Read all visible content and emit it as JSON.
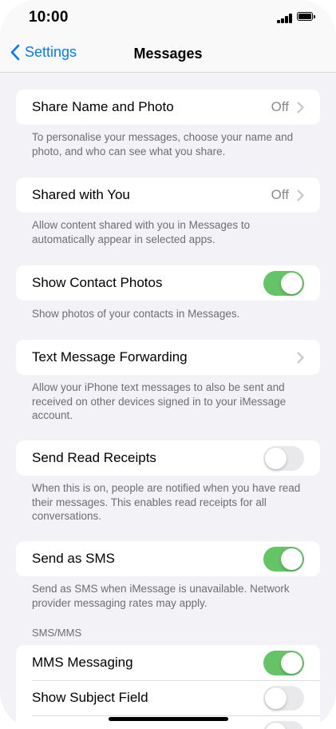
{
  "status_bar": {
    "time": "10:00"
  },
  "nav": {
    "back_label": "Settings",
    "title": "Messages"
  },
  "rows": {
    "share_name_photo": {
      "label": "Share Name and Photo",
      "value": "Off"
    },
    "shared_with_you": {
      "label": "Shared with You",
      "value": "Off"
    },
    "show_contact_photos": {
      "label": "Show Contact Photos",
      "toggle_on": true
    },
    "text_message_forwarding": {
      "label": "Text Message Forwarding"
    },
    "send_read_receipts": {
      "label": "Send Read Receipts",
      "toggle_on": false
    },
    "send_as_sms": {
      "label": "Send as SMS",
      "toggle_on": true
    },
    "mms_messaging": {
      "label": "MMS Messaging",
      "toggle_on": true
    },
    "show_subject_field": {
      "label": "Show Subject Field",
      "toggle_on": false
    },
    "character_count": {
      "toggle_on": false
    }
  },
  "footers": {
    "share_name_photo": "To personalise your messages, choose your name and photo, and who can see what you share.",
    "shared_with_you": "Allow content shared with you in Messages to automatically appear in selected apps.",
    "show_contact_photos": "Show photos of your contacts in Messages.",
    "text_message_forwarding": "Allow your iPhone text messages to also be sent and received on other devices signed in to your iMessage account.",
    "send_read_receipts": "When this is on, people are notified when you have read their messages. This enables read receipts for all conversations.",
    "send_as_sms": "Send as SMS when iMessage is unavailable. Network provider messaging rates may apply."
  },
  "sections": {
    "sms_mms_header": "SMS/MMS"
  },
  "colors": {
    "accent": "#007aff",
    "toggle_on": "#65c466",
    "toggle_off": "#e9e9eb",
    "background": "#f2f2f7"
  },
  "icons": [
    "chevron-left-icon",
    "chevron-right-icon",
    "signal-icon",
    "battery-icon"
  ]
}
